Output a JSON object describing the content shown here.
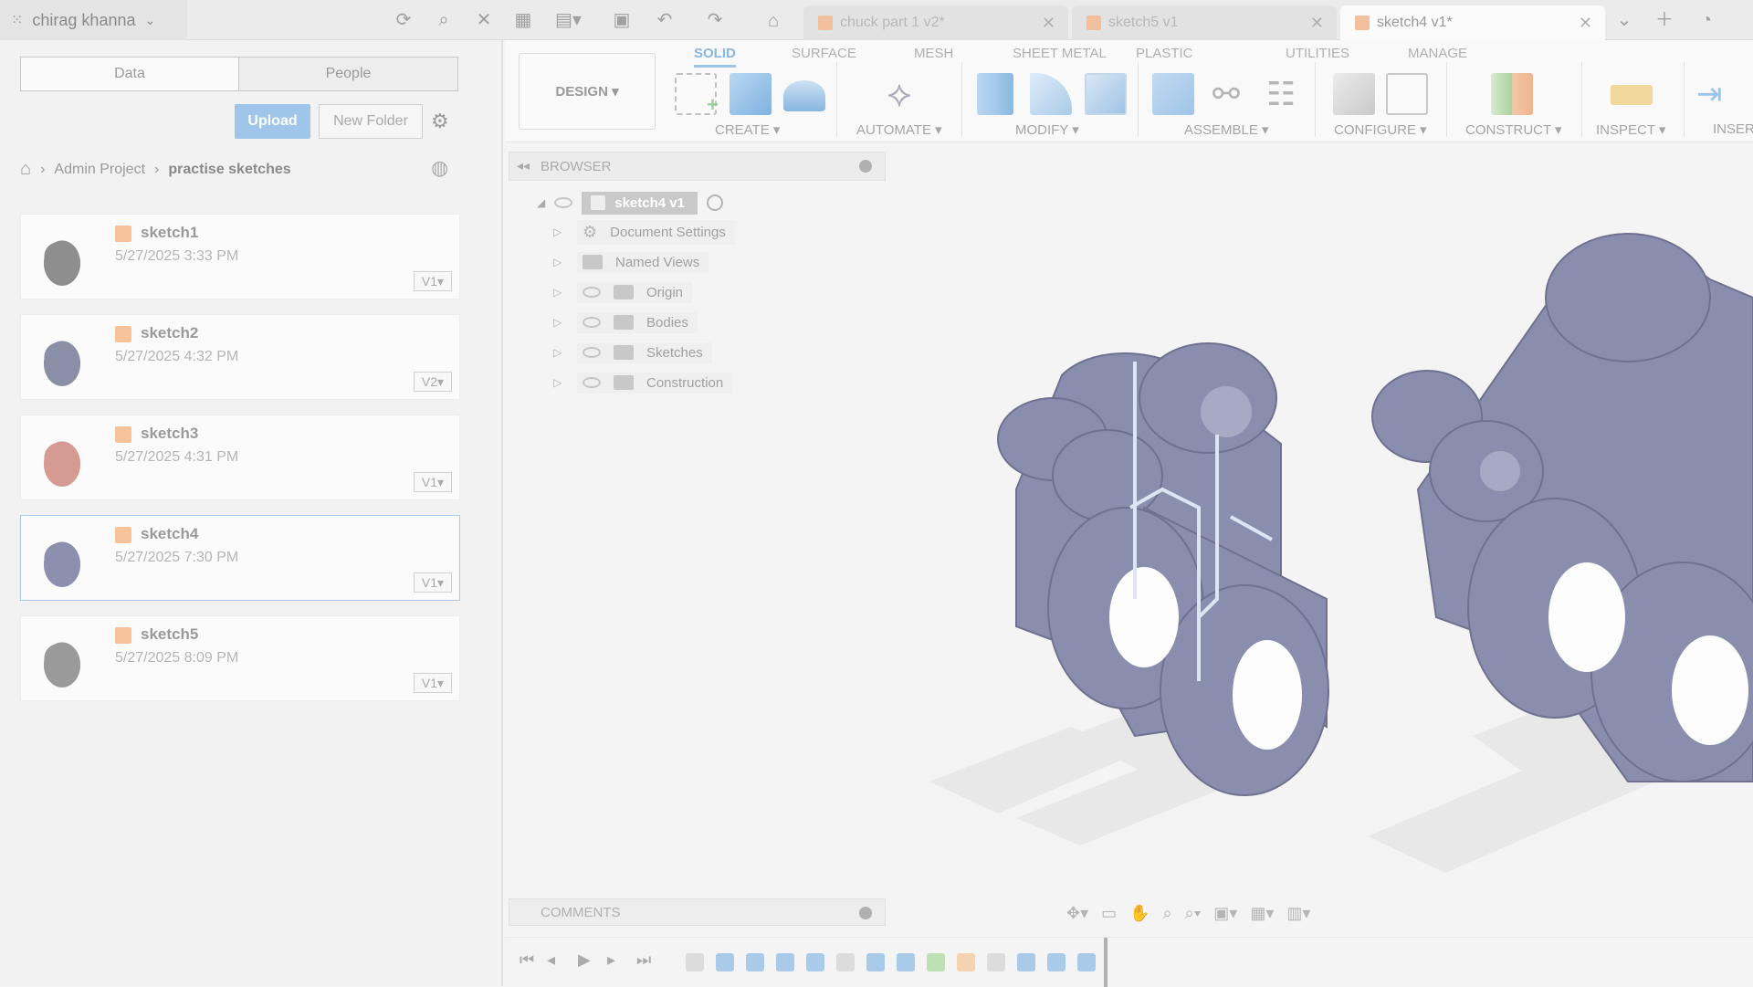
{
  "topbar": {
    "user_name": "chirag khanna",
    "tabs": [
      {
        "label": "chuck part 1 v2*",
        "active": false
      },
      {
        "label": "sketch5 v1",
        "active": false
      },
      {
        "label": "sketch4 v1*",
        "active": true
      }
    ]
  },
  "data_panel": {
    "segment_data": "Data",
    "segment_people": "People",
    "upload_label": "Upload",
    "new_folder_label": "New Folder",
    "breadcrumb": [
      "Admin Project",
      "practise sketches"
    ],
    "files": [
      {
        "name": "sketch1",
        "date": "5/27/2025 3:33 PM",
        "version": "V1",
        "thumb_color": "#8e8e8e"
      },
      {
        "name": "sketch2",
        "date": "5/27/2025 4:32 PM",
        "version": "V2",
        "thumb_color": "#8a8fa8"
      },
      {
        "name": "sketch3",
        "date": "5/27/2025 4:31 PM",
        "version": "V1",
        "thumb_color": "#d59a92"
      },
      {
        "name": "sketch4",
        "date": "5/27/2025 7:30 PM",
        "version": "V1",
        "thumb_color": "#8c8fad",
        "selected": true
      },
      {
        "name": "sketch5",
        "date": "5/27/2025 8:09 PM",
        "version": "V1",
        "thumb_color": "#9a9a9a"
      }
    ]
  },
  "ribbon": {
    "design_label": "DESIGN ▾",
    "tabs": [
      "SOLID",
      "SURFACE",
      "MESH",
      "SHEET METAL",
      "PLASTIC",
      "UTILITIES",
      "MANAGE"
    ],
    "active_tab": "SOLID",
    "groups": [
      "CREATE ▾",
      "AUTOMATE ▾",
      "MODIFY ▾",
      "ASSEMBLE ▾",
      "CONFIGURE ▾",
      "CONSTRUCT ▾",
      "INSPECT ▾",
      "INSER"
    ]
  },
  "browser": {
    "title": "BROWSER",
    "root": "sketch4 v1",
    "nodes": [
      "Document Settings",
      "Named Views",
      "Origin",
      "Bodies",
      "Sketches",
      "Construction"
    ]
  },
  "comments": {
    "title": "COMMENTS"
  },
  "colors": {
    "accent": "#9ec6ea",
    "model": "#7e82a4",
    "orange_cube": "#f6c39b"
  }
}
